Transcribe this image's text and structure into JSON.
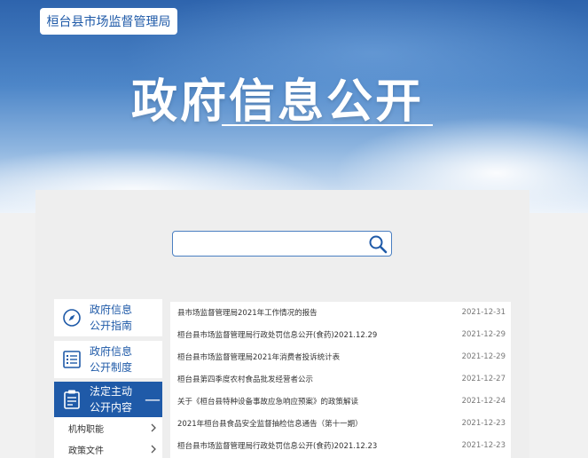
{
  "header": {
    "agency_name": "桓台县市场监督管理局",
    "page_title": "政府信息公开"
  },
  "search": {
    "placeholder": ""
  },
  "sidebar": {
    "items": [
      {
        "label": "政府信息\n公开指南",
        "icon": "compass-icon"
      },
      {
        "label": "政府信息\n公开制度",
        "icon": "document-list-icon"
      },
      {
        "label": "法定主动\n公开内容",
        "icon": "clipboard-icon",
        "active": true
      }
    ],
    "subitems": [
      {
        "label": "机构职能"
      },
      {
        "label": "政策文件"
      }
    ]
  },
  "news": [
    {
      "title": "县市场监督管理局2021年工作情况的报告",
      "date": "2021-12-31"
    },
    {
      "title": "桓台县市场监督管理局行政处罚信息公开(食药)2021.12.29",
      "date": "2021-12-29"
    },
    {
      "title": "桓台县市场监督管理局2021年消费者投诉统计表",
      "date": "2021-12-29"
    },
    {
      "title": "桓台县第四季度农村食品批发经营者公示",
      "date": "2021-12-27"
    },
    {
      "title": "关于《桓台县特种设备事故应急响应预案》的政策解读",
      "date": "2021-12-24"
    },
    {
      "title": "2021年桓台县食品安全监督抽检信息通告（第十一期）",
      "date": "2021-12-23"
    },
    {
      "title": "桓台县市场监督管理局行政处罚信息公开(食药)2021.12.23",
      "date": "2021-12-23"
    }
  ],
  "colors": {
    "primary": "#1f5aa8",
    "panel": "#eeeeee"
  }
}
